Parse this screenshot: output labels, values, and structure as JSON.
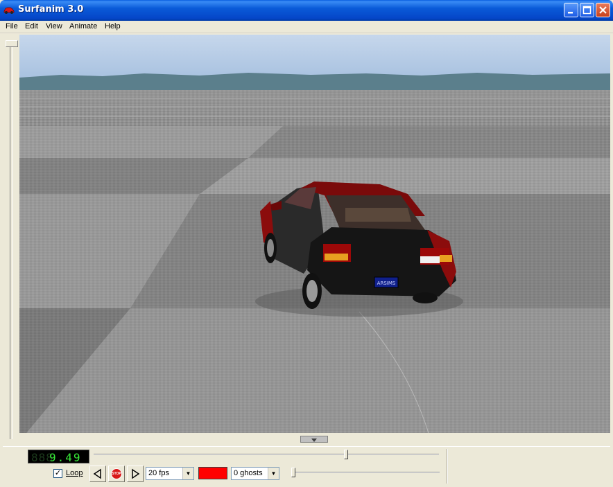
{
  "window": {
    "title": "Surfanim 3.0",
    "controls": [
      "minimize",
      "maximize",
      "close"
    ]
  },
  "menu": {
    "items": [
      "File",
      "Edit",
      "View",
      "Animate",
      "Help"
    ]
  },
  "scene": {
    "license_plate": "ARSIMS",
    "car_color": "#8b0c0c"
  },
  "controls": {
    "time_display_dim": "888",
    "time_display": "9.49",
    "loop_label": "Loop",
    "loop_checked": true,
    "loop_check_glyph": "✓",
    "stop_label": "STOP",
    "fps_value": "20 fps",
    "ghost_color": "#ff0000",
    "ghosts_value": "0 ghosts",
    "time_slider_position": 0.73,
    "ghost_slider_position": 0.0
  }
}
